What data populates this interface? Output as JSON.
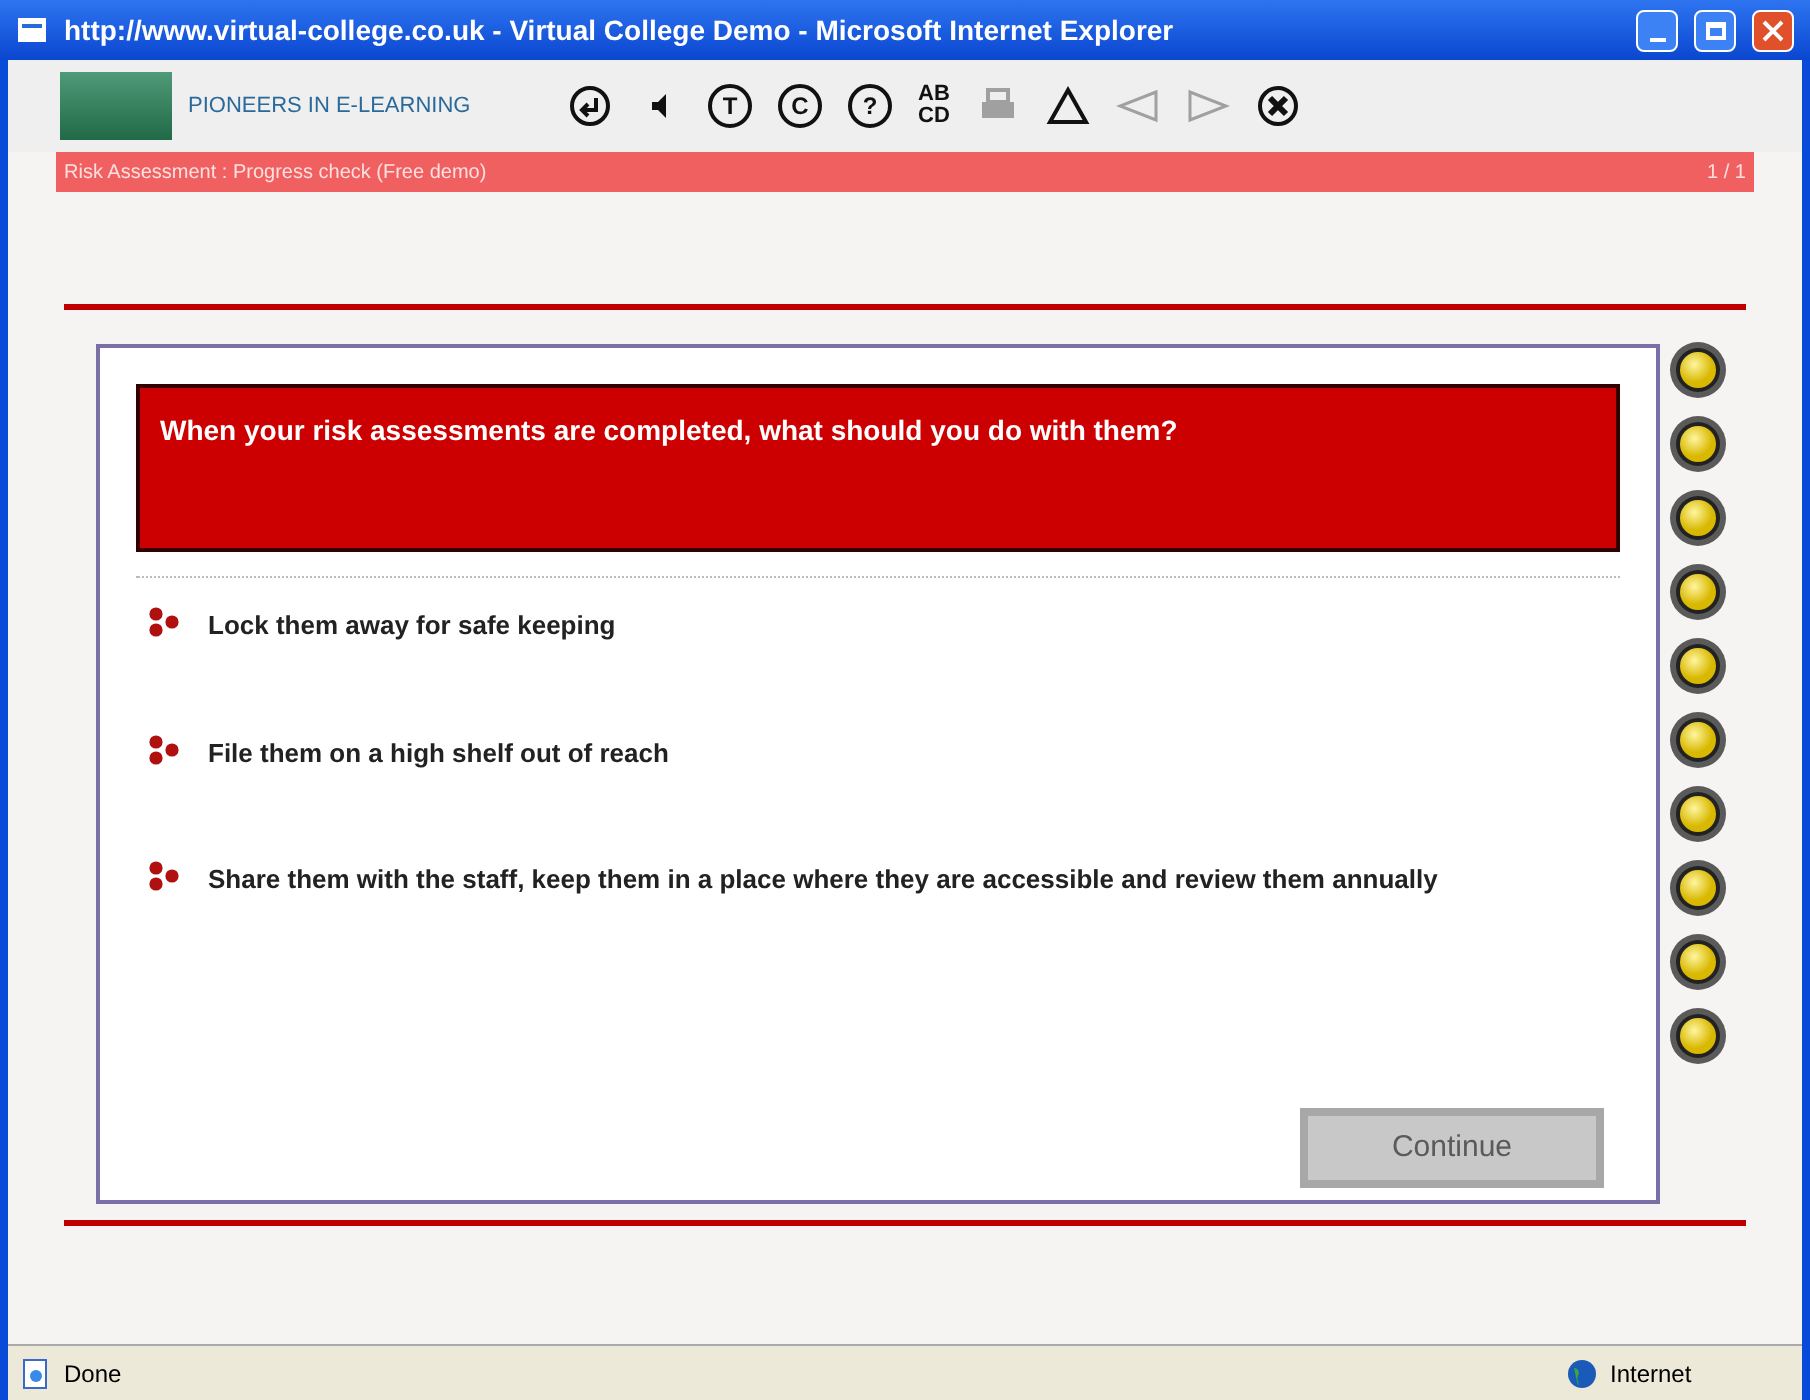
{
  "window": {
    "title": "http://www.virtual-college.co.uk - Virtual College Demo - Microsoft Internet Explorer"
  },
  "header": {
    "tagline": "PIONEERS IN E-LEARNING"
  },
  "toolbar": [
    {
      "kind": "back",
      "disabled": false
    },
    {
      "kind": "audio",
      "disabled": false
    },
    {
      "kind": "circled",
      "label": "T",
      "disabled": false
    },
    {
      "kind": "circled",
      "label": "C",
      "disabled": false
    },
    {
      "kind": "circled",
      "label": "?",
      "disabled": false
    },
    {
      "kind": "glossary",
      "label": "AB",
      "label2": "CD",
      "disabled": false
    },
    {
      "kind": "print",
      "disabled": true
    },
    {
      "kind": "up",
      "disabled": false
    },
    {
      "kind": "prev",
      "disabled": true
    },
    {
      "kind": "next",
      "disabled": true
    },
    {
      "kind": "exit",
      "disabled": false
    }
  ],
  "breadcrumb": {
    "text": "Risk Assessment : Progress check (Free demo)",
    "page": "1 / 1"
  },
  "question": "When your risk assessments are completed, what should you do with them?",
  "options": [
    {
      "text": "Lock them away for safe keeping"
    },
    {
      "text": "File them on a high shelf out of reach"
    },
    {
      "text": "Share them with the staff, keep them in a place where they are accessible and review them annually"
    }
  ],
  "continue_button": {
    "label": "Continue",
    "disabled": true
  },
  "status_bar": {
    "text": "Done",
    "zone": "Internet"
  }
}
